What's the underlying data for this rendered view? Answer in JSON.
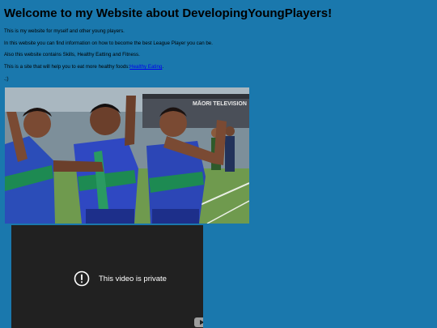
{
  "heading": "Welcome to my Website about DevelopingYoungPlayers!",
  "paragraphs": [
    "This is my website for myself and other young players.",
    "In this website you can find information on how to become the best League Player you can be.",
    "Also this website contains Skills, Healthy Eatting and Fitness."
  ],
  "healthy_line": {
    "prefix": "This is a site that will help you to eat more healthy foods:",
    "link_label": "Healthy Eating",
    "suffix": "."
  },
  "stray_text": ".;)",
  "image": {
    "alt": "Young rugby league players performing a haka",
    "banner_text": "MĀORI TELEVISION"
  },
  "video": {
    "status_text": "This video is private",
    "icons": {
      "status": "exclamation-circle-icon",
      "brand": "youtube-icon"
    }
  },
  "colors": {
    "page_background": "#1a78ad",
    "link": "#0000ee",
    "video_background": "#212121"
  }
}
